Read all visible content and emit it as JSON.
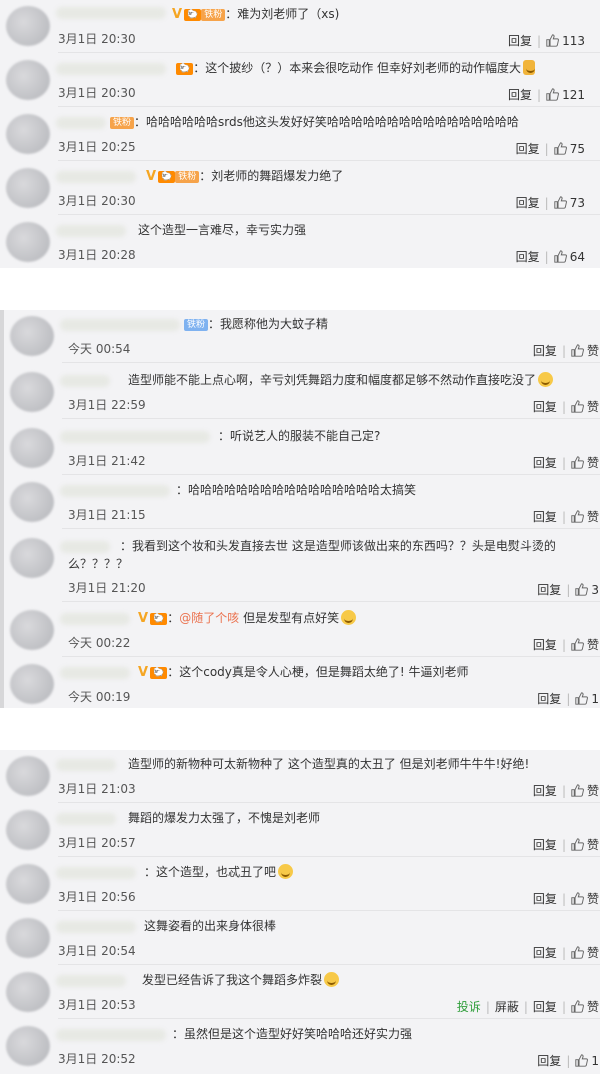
{
  "panels": [
    {
      "comments": [
        {
          "text": "难为刘老师了（xs)",
          "time": "3月1日 20:30",
          "likes": "113",
          "vbadge": "V",
          "lvbadge": "🐑",
          "fanbadge": "铁粉"
        },
        {
          "text": "这个披纱（？）本来会很吃动作 但幸好刘老师的动作幅度大",
          "time": "3月1日 20:30",
          "likes": "121",
          "lvbadge": "🐑"
        },
        {
          "text": "哈哈哈哈哈哈srds他这头发好好笑哈哈哈哈哈哈哈哈哈哈哈哈哈哈哈哈",
          "time": "3月1日 20:25",
          "likes": "75",
          "fanbadge": "铁粉"
        },
        {
          "text": "刘老师的舞蹈爆发力绝了",
          "time": "3月1日 20:30",
          "likes": "73",
          "vbadge": "V",
          "lvbadge": "🐑",
          "fanbadge": "铁粉"
        },
        {
          "text": "这个造型一言难尽，幸亏实力强",
          "time": "3月1日 20:28",
          "likes": "64"
        }
      ]
    },
    {
      "comments": [
        {
          "text": "我愿称他为大蚊子精",
          "time": "今天 00:54",
          "likes": "赞",
          "fanbadge": "铁粉"
        },
        {
          "text": "造型师能不能上点心啊，辛亏刘凭舞蹈力度和幅度都足够不然动作直接吃没了",
          "time": "3月1日 22:59",
          "likes": "赞"
        },
        {
          "text": "听说艺人的服装不能自己定?",
          "time": "3月1日 21:42",
          "likes": "赞"
        },
        {
          "text": "哈哈哈哈哈哈哈哈哈哈哈哈哈哈哈哈太搞笑",
          "time": "3月1日 21:15",
          "likes": "赞"
        },
        {
          "text": "我看到这个妆和头发直接去世 这是造型师该做出来的东西吗？？头是电熨斗烫的么？？？？",
          "time": "3月1日 21:20",
          "likes": "3"
        },
        {
          "text": "@随了个咳 但是发型有点好笑",
          "mention": "@随了个咳",
          "rest": " 但是发型有点好笑",
          "time": "今天 00:22",
          "likes": "赞",
          "vbadge": "V",
          "lvbadge": "🐑"
        },
        {
          "text": "这个cody真是令人心梗，但是舞蹈太绝了! 牛逼刘老师",
          "time": "今天 00:19",
          "likes": "1",
          "vbadge": "V",
          "lvbadge": "🐑"
        }
      ]
    },
    {
      "comments": [
        {
          "text": "造型师的新物种可太新物种了 这个造型真的太丑了 但是刘老师牛牛牛!好绝!",
          "time": "3月1日 21:03",
          "likes": "赞"
        },
        {
          "text": "舞蹈的爆发力太强了，不愧是刘老师",
          "time": "3月1日 20:57",
          "likes": "赞"
        },
        {
          "text": "这个造型，也忒丑了吧",
          "time": "3月1日 20:56",
          "likes": "赞"
        },
        {
          "text": "这舞姿看的出来身体很棒",
          "time": "3月1日 20:54",
          "likes": "赞"
        },
        {
          "text": "发型已经告诉了我这个舞蹈多炸裂",
          "time": "3月1日 20:53",
          "likes": "赞",
          "report": "投诉",
          "block": "屏蔽"
        },
        {
          "text": "虽然但是这个造型好好笑哈哈哈还好实力强",
          "time": "3月1日 20:52",
          "likes": "1"
        }
      ]
    }
  ],
  "labels": {
    "reply": "回复"
  },
  "colors": {
    "panel_bg": "#f3f3f5",
    "report": "#2f9e3a",
    "mention": "#eb7350",
    "vip": "#f5a623",
    "fan": "#f6a34a"
  }
}
